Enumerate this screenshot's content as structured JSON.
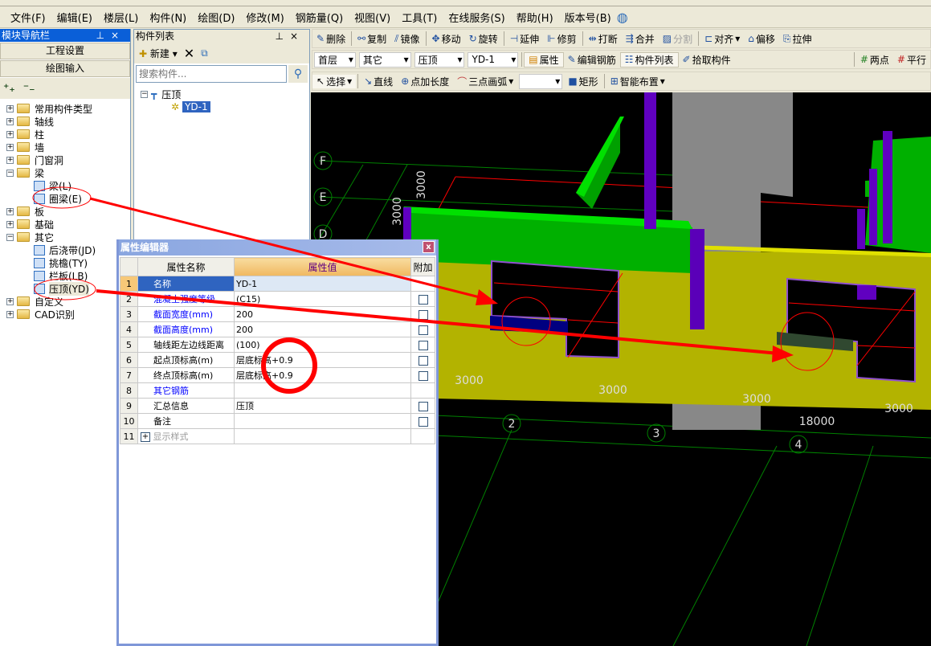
{
  "menu": [
    "文件(F)",
    "编辑(E)",
    "楼层(L)",
    "构件(N)",
    "绘图(D)",
    "修改(M)",
    "钢筋量(Q)",
    "视图(V)",
    "工具(T)",
    "在线服务(S)",
    "帮助(H)",
    "版本号(B)"
  ],
  "nav": {
    "title": "模块导航栏",
    "buttons": [
      "工程设置",
      "绘图输入"
    ],
    "tree": [
      {
        "label": "常用构件类型",
        "type": "folder",
        "state": "collapsed"
      },
      {
        "label": "轴线",
        "type": "folder",
        "state": "collapsed"
      },
      {
        "label": "柱",
        "type": "folder",
        "state": "collapsed"
      },
      {
        "label": "墙",
        "type": "folder",
        "state": "collapsed"
      },
      {
        "label": "门窗洞",
        "type": "folder",
        "state": "collapsed"
      },
      {
        "label": "梁",
        "type": "folder",
        "state": "expanded"
      },
      {
        "label": "梁(L)",
        "type": "child"
      },
      {
        "label": "圈梁(E)",
        "type": "child"
      },
      {
        "label": "板",
        "type": "folder",
        "state": "collapsed"
      },
      {
        "label": "基础",
        "type": "folder",
        "state": "collapsed"
      },
      {
        "label": "其它",
        "type": "folder",
        "state": "expanded"
      },
      {
        "label": "后浇带(JD)",
        "type": "child"
      },
      {
        "label": "挑檐(TY)",
        "type": "child"
      },
      {
        "label": "栏板(LB)",
        "type": "child"
      },
      {
        "label": "压顶(YD)",
        "type": "child",
        "selected": true
      },
      {
        "label": "自定义",
        "type": "folder",
        "state": "collapsed"
      },
      {
        "label": "CAD识别",
        "type": "folder",
        "state": "collapsed"
      }
    ]
  },
  "complist": {
    "title": "构件列表",
    "new_label": "新建",
    "search_placeholder": "搜索构件...",
    "root": "压顶",
    "item": "YD-1"
  },
  "toolbar1": [
    "删除",
    "复制",
    "镜像",
    "移动",
    "旋转",
    "延伸",
    "修剪",
    "打断",
    "合并",
    "分割",
    "对齐",
    "偏移",
    "拉伸"
  ],
  "toolbar2": {
    "floor": "首层",
    "category": "其它",
    "type": "压顶",
    "component": "YD-1",
    "buttons": [
      "属性",
      "编辑钢筋",
      "构件列表",
      "拾取构件"
    ],
    "right": [
      "两点",
      "平行"
    ]
  },
  "toolbar3": {
    "select": "选择",
    "buttons": [
      "直线",
      "点加长度",
      "三点画弧",
      "矩形",
      "智能布置"
    ]
  },
  "viewport": {
    "axis_letters": [
      "F",
      "E",
      "D"
    ],
    "axis_numbers": [
      "2",
      "3",
      "4"
    ],
    "dims": [
      "3000",
      "3000",
      "3000",
      "3000",
      "3000",
      "3000",
      "18000"
    ]
  },
  "dialog": {
    "title": "属性编辑器",
    "headers": [
      "属性名称",
      "属性值",
      "附加"
    ],
    "rows": [
      {
        "n": "1",
        "name": "名称",
        "value": "YD-1",
        "blue": false,
        "cb": false
      },
      {
        "n": "2",
        "name": "混凝土强度等级",
        "value": "(C15)",
        "blue": true,
        "cb": true
      },
      {
        "n": "3",
        "name": "截面宽度(mm)",
        "value": "200",
        "blue": true,
        "cb": true
      },
      {
        "n": "4",
        "name": "截面高度(mm)",
        "value": "200",
        "blue": true,
        "cb": true
      },
      {
        "n": "5",
        "name": "轴线距左边线距离",
        "value": "(100)",
        "blue": false,
        "cb": true
      },
      {
        "n": "6",
        "name": "起点顶标高(m)",
        "value": "层底标高+0.9",
        "blue": false,
        "cb": true
      },
      {
        "n": "7",
        "name": "终点顶标高(m)",
        "value": "层底标高+0.9",
        "blue": false,
        "cb": true
      },
      {
        "n": "8",
        "name": "其它钢筋",
        "value": "",
        "blue": true,
        "cb": false
      },
      {
        "n": "9",
        "name": "汇总信息",
        "value": "压顶",
        "blue": false,
        "cb": true
      },
      {
        "n": "10",
        "name": "备注",
        "value": "",
        "blue": false,
        "cb": true
      },
      {
        "n": "11",
        "name": "显示样式",
        "value": "",
        "blue": false,
        "cb": false,
        "expand": true
      }
    ]
  },
  "colors": {
    "annotation": "#ff0000",
    "title_blue": "#0a5fd8",
    "viewport_bg": "#000000",
    "wall": "#b3b300",
    "beam": "#00c000",
    "column": "#6000c0"
  }
}
